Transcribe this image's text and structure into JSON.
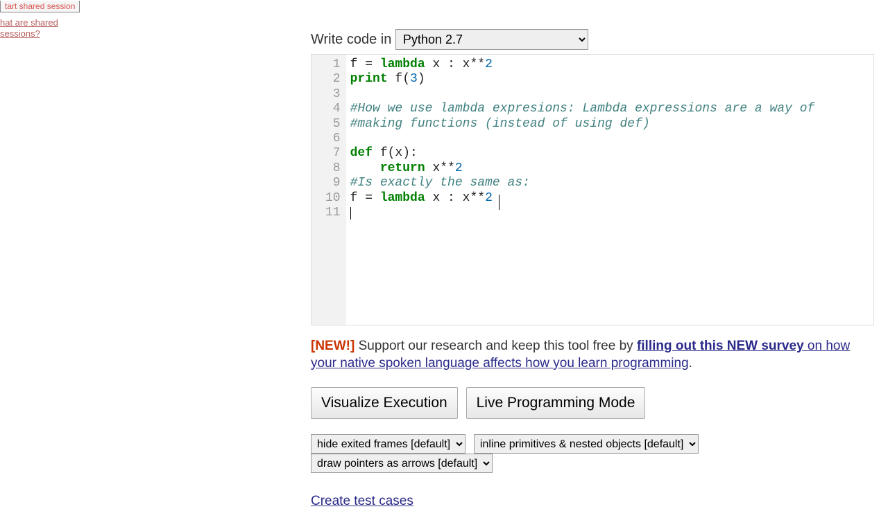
{
  "sidebar": {
    "shared_btn": "tart shared session",
    "shared_link": "hat are shared sessions?"
  },
  "lang": {
    "label": "Write code in",
    "selected": "Python 2.7"
  },
  "code": {
    "gutter": "1\n2\n3\n4\n5\n6\n7\n8\n9\n10\n11",
    "l1_a": "f = ",
    "l1_kw": "lambda",
    "l1_b": " x : x**",
    "l1_n": "2",
    "l2_kw": "print",
    "l2_b": " f(",
    "l2_n": "3",
    "l2_c": ")",
    "l4_com": "#How we use lambda expresions: Lambda expressions are a way of",
    "l5_com": "#making functions (instead of using def)",
    "l7_kw": "def",
    "l7_b": " f(x):",
    "l8_sp": "    ",
    "l8_kw": "return",
    "l8_b": " x**",
    "l8_n": "2",
    "l9_com": "#Is exactly the same as:",
    "l10_a": "f = ",
    "l10_kw": "lambda",
    "l10_b": " x : x**",
    "l10_n": "2"
  },
  "notice": {
    "tag": "[NEW!]",
    "pre": " Support our research and keep this tool free by ",
    "link": "filling out this NEW survey",
    "post1": " on how your native spoken language affects how you learn programming",
    "dot": "."
  },
  "buttons": {
    "visualize": "Visualize Execution",
    "live": "Live Programming Mode"
  },
  "options": {
    "frames": "hide exited frames [default]",
    "inline": "inline primitives & nested objects [default]",
    "pointers": "draw pointers as arrows [default]"
  },
  "links": {
    "tests": "Create test cases"
  }
}
